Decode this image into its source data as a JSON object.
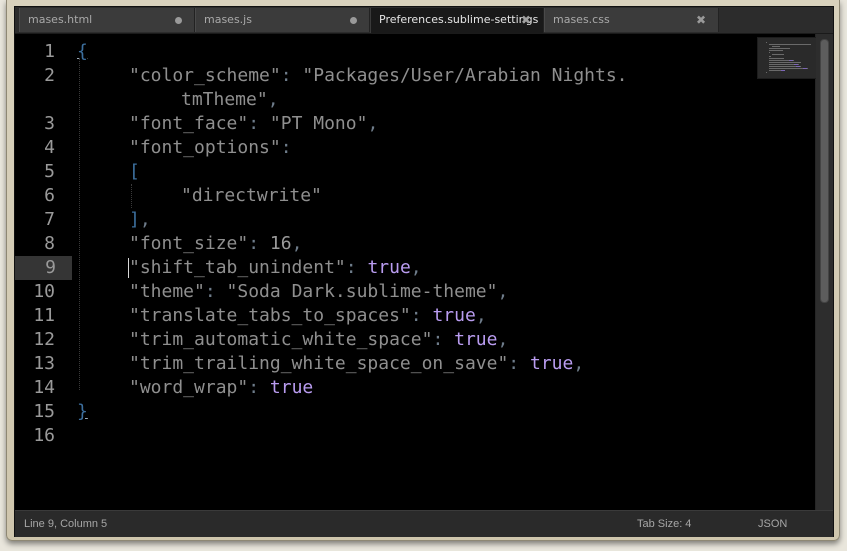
{
  "tabs": [
    {
      "label": "mases.html",
      "state": "modified",
      "icon": "dot-icon"
    },
    {
      "label": "mases.js",
      "state": "modified",
      "icon": "dot-icon"
    },
    {
      "label": "Preferences.sublime-settings",
      "state": "active",
      "icon": "close-icon",
      "glyph": "✖"
    },
    {
      "label": "mases.css",
      "state": "saved",
      "icon": "close-icon",
      "glyph": "✖"
    }
  ],
  "editor": {
    "line_numbers": [
      "1",
      "2",
      "",
      "3",
      "4",
      "5",
      "6",
      "7",
      "8",
      "9",
      "10",
      "11",
      "12",
      "13",
      "14",
      "15",
      "16"
    ],
    "current_line": "9",
    "lines": [
      {
        "n": "1",
        "tokens": [
          {
            "t": "{",
            "c": "brace u"
          }
        ]
      },
      {
        "n": "2",
        "indent": 1,
        "tokens": [
          {
            "t": "\"color_scheme\"",
            "c": "str"
          },
          {
            "t": ": ",
            "c": "punc"
          },
          {
            "t": "\"Packages/User/Arabian Nights.",
            "c": "str"
          }
        ]
      },
      {
        "n": "",
        "indent": 2,
        "tokens": [
          {
            "t": "tmTheme\"",
            "c": "str"
          },
          {
            "t": ",",
            "c": "punc"
          }
        ]
      },
      {
        "n": "3",
        "indent": 1,
        "tokens": [
          {
            "t": "\"font_face\"",
            "c": "str"
          },
          {
            "t": ": ",
            "c": "punc"
          },
          {
            "t": "\"PT Mono\"",
            "c": "str"
          },
          {
            "t": ",",
            "c": "punc"
          }
        ]
      },
      {
        "n": "4",
        "indent": 1,
        "tokens": [
          {
            "t": "\"font_options\"",
            "c": "str"
          },
          {
            "t": ":",
            "c": "punc"
          }
        ]
      },
      {
        "n": "5",
        "indent": 1,
        "tokens": [
          {
            "t": "[",
            "c": "brace"
          }
        ]
      },
      {
        "n": "6",
        "indent": 2,
        "tokens": [
          {
            "t": "\"directwrite\"",
            "c": "str"
          }
        ]
      },
      {
        "n": "7",
        "indent": 1,
        "tokens": [
          {
            "t": "]",
            "c": "brace"
          },
          {
            "t": ",",
            "c": "punc"
          }
        ]
      },
      {
        "n": "8",
        "indent": 1,
        "tokens": [
          {
            "t": "\"font_size\"",
            "c": "str"
          },
          {
            "t": ": ",
            "c": "punc"
          },
          {
            "t": "16",
            "c": "num"
          },
          {
            "t": ",",
            "c": "punc"
          }
        ]
      },
      {
        "n": "9",
        "indent": 1,
        "tokens": [
          {
            "t": "\"shift_tab_unindent\"",
            "c": "str"
          },
          {
            "t": ": ",
            "c": "punc"
          },
          {
            "t": "true",
            "c": "bool"
          },
          {
            "t": ",",
            "c": "punc"
          }
        ]
      },
      {
        "n": "10",
        "indent": 1,
        "tokens": [
          {
            "t": "\"theme\"",
            "c": "str"
          },
          {
            "t": ": ",
            "c": "punc"
          },
          {
            "t": "\"Soda Dark.sublime-theme\"",
            "c": "str"
          },
          {
            "t": ",",
            "c": "punc"
          }
        ]
      },
      {
        "n": "11",
        "indent": 1,
        "tokens": [
          {
            "t": "\"translate_tabs_to_spaces\"",
            "c": "str"
          },
          {
            "t": ": ",
            "c": "punc"
          },
          {
            "t": "true",
            "c": "bool"
          },
          {
            "t": ",",
            "c": "punc"
          }
        ]
      },
      {
        "n": "12",
        "indent": 1,
        "tokens": [
          {
            "t": "\"trim_automatic_white_space\"",
            "c": "str"
          },
          {
            "t": ": ",
            "c": "punc"
          },
          {
            "t": "true",
            "c": "bool"
          },
          {
            "t": ",",
            "c": "punc"
          }
        ]
      },
      {
        "n": "13",
        "indent": 1,
        "tokens": [
          {
            "t": "\"trim_trailing_white_space_on_save\"",
            "c": "str"
          },
          {
            "t": ": ",
            "c": "punc"
          },
          {
            "t": "true",
            "c": "bool"
          },
          {
            "t": ",",
            "c": "punc"
          }
        ]
      },
      {
        "n": "14",
        "indent": 1,
        "tokens": [
          {
            "t": "\"word_wrap\"",
            "c": "str"
          },
          {
            "t": ": ",
            "c": "punc"
          },
          {
            "t": "true",
            "c": "bool"
          }
        ]
      },
      {
        "n": "15",
        "tokens": [
          {
            "t": "}",
            "c": "brace u"
          }
        ]
      },
      {
        "n": "16",
        "tokens": []
      }
    ]
  },
  "status_bar": {
    "position": "Line 9, Column 5",
    "tab_size": "Tab Size: 4",
    "syntax": "JSON"
  },
  "colors": {
    "bool": "#b99cf0",
    "brace": "#3c6f9e",
    "string": "#8f8f8f",
    "background": "#000000"
  }
}
